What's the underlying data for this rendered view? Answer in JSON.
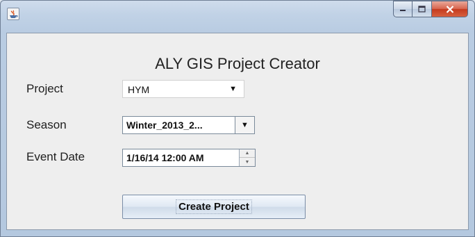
{
  "window": {
    "icons": {
      "app": "java-icon",
      "minimize": "minimize-icon",
      "maximize": "maximize-icon",
      "close": "close-icon"
    },
    "colors": {
      "close_button": "#c43b1f",
      "frame": "#b9cce2",
      "panel": "#eeeeee"
    }
  },
  "form": {
    "title": "ALY GIS Project Creator",
    "project": {
      "label": "Project",
      "value": "HYM"
    },
    "season": {
      "label": "Season",
      "value": "Winter_2013_2..."
    },
    "event_date": {
      "label": "Event Date",
      "value": "1/16/14 12:00 AM"
    },
    "create_button": "Create Project"
  }
}
